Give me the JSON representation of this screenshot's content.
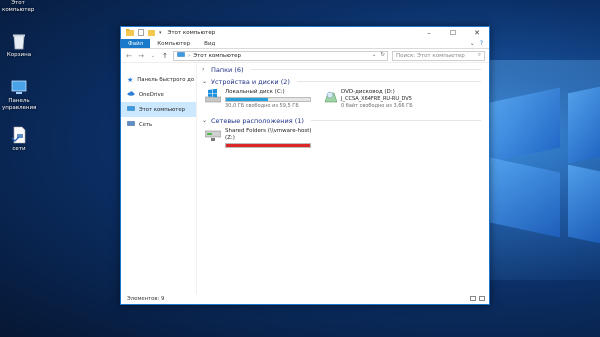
{
  "desktop": {
    "icons": [
      {
        "label": "Этот компьютер",
        "icon": "computer-icon"
      },
      {
        "label": "Корзина",
        "icon": "recycle-bin-icon"
      },
      {
        "label": "Панель управления",
        "icon": "control-panel-icon"
      },
      {
        "label": "сети",
        "icon": "network-shortcut-icon"
      }
    ]
  },
  "window": {
    "title": "Этот компьютер",
    "tabs": [
      "Файл",
      "Компьютер",
      "Вид"
    ],
    "address": {
      "path": "Этот компьютер",
      "search_placeholder": "Поиск: Этот компьютер"
    },
    "sidebar": [
      {
        "label": "Панель быстрого до",
        "icon": "star-icon"
      },
      {
        "label": "OneDrive",
        "icon": "cloud-icon"
      },
      {
        "label": "Этот компьютер",
        "icon": "computer-icon",
        "selected": true
      },
      {
        "label": "Сеть",
        "icon": "network-icon"
      }
    ],
    "groups": {
      "folders": "Папки (6)",
      "devices": "Устройства и диски (2)",
      "network": "Сетевые расположения (1)"
    },
    "drives": {
      "local": {
        "name": "Локальный диск (C:)",
        "free": "30,0 ГБ свободно из 59,5 ГБ",
        "used_fraction": 0.5,
        "bar_color": "#26a0da"
      },
      "dvd": {
        "name": "DVD-дисковод (D:)",
        "label": "J_CCSA_X64FRE_RU-RU_DV5",
        "free": "0 байт свободно из 3,66 ГБ"
      },
      "shared": {
        "name": "Shared Folders (\\\\vmware-host)",
        "letter": "(Z:)",
        "used_fraction": 1.0,
        "bar_color": "#da2626"
      }
    },
    "status": "Элементов: 9"
  }
}
